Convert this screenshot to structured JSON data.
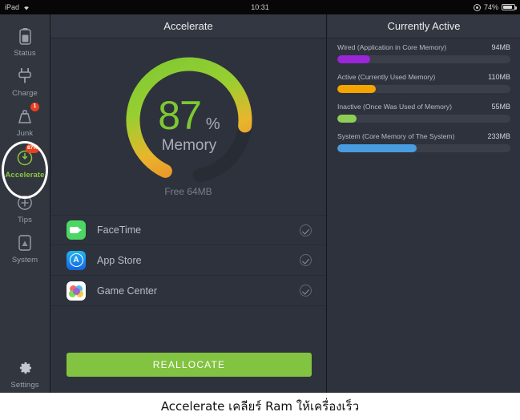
{
  "status_bar": {
    "device": "iPad",
    "wifi_icon": "wifi-icon",
    "time": "10:31",
    "lock_icon": "rotation-lock-icon",
    "battery_percent": "74%",
    "battery_icon": "battery-icon"
  },
  "sidebar": {
    "items": [
      {
        "label": "Status",
        "icon": "battery-icon",
        "badge": "",
        "active": false
      },
      {
        "label": "Charge",
        "icon": "plug-icon",
        "badge": "",
        "active": false
      },
      {
        "label": "Junk",
        "icon": "trash-icon",
        "badge": "1",
        "active": false
      },
      {
        "label": "Accelerate",
        "icon": "speedometer-icon",
        "badge": "87%",
        "active": true
      },
      {
        "label": "Tips",
        "icon": "plus-circle-icon",
        "badge": "",
        "active": false
      },
      {
        "label": "System",
        "icon": "device-icon",
        "badge": "",
        "active": false
      }
    ],
    "settings": {
      "label": "Settings",
      "icon": "gear-icon"
    }
  },
  "center": {
    "title": "Accelerate",
    "gauge": {
      "value": "87",
      "unit": "%",
      "caption": "Memory",
      "free_label": "Free 64MB",
      "percent": 87,
      "start_color": "#7cc832",
      "end_color": "#f07d25",
      "track_color": "#282c34"
    },
    "apps": [
      {
        "name": "FaceTime",
        "icon": "facetime-icon",
        "checked": true
      },
      {
        "name": "App Store",
        "icon": "app-store-icon",
        "checked": true
      },
      {
        "name": "Game Center",
        "icon": "game-center-icon",
        "checked": true
      }
    ],
    "reallocate_label": "REALLOCATE"
  },
  "right": {
    "title": "Currently Active",
    "memory": [
      {
        "label": "Wired (Application in Core Memory)",
        "value": "94MB",
        "fill": 19,
        "color": "#9b26d8"
      },
      {
        "label": "Active (Currently Used Memory)",
        "value": "110MB",
        "fill": 22,
        "color": "#f5a400"
      },
      {
        "label": "Inactive (Once Was Used of Memory)",
        "value": "55MB",
        "fill": 11,
        "color": "#8ece55"
      },
      {
        "label": "System (Core Memory of The System)",
        "value": "233MB",
        "fill": 46,
        "color": "#4a9ce0"
      }
    ]
  },
  "caption": "Accelerate เคลียร์  Ram  ให้เครื่องเร็ว"
}
